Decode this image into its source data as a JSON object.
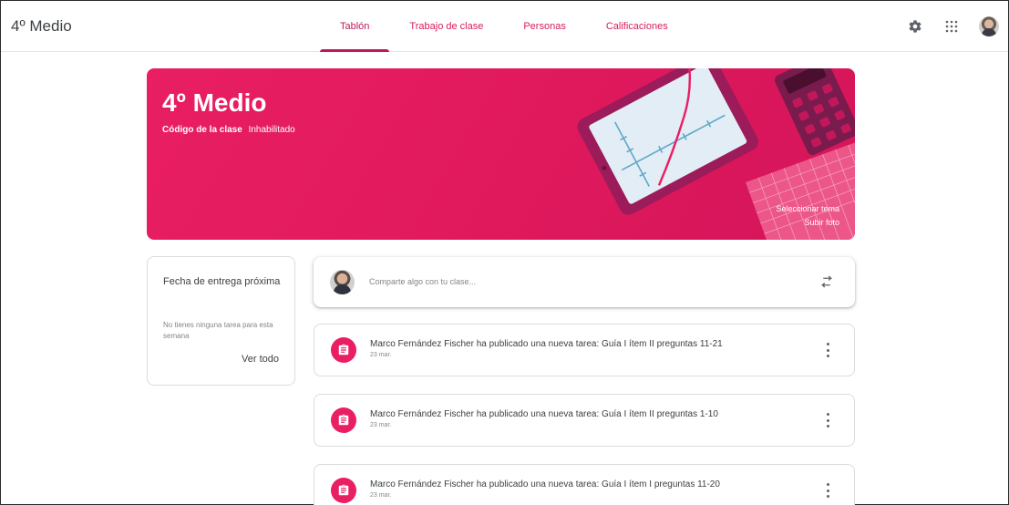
{
  "header": {
    "class_name": "4º Medio",
    "tabs": [
      {
        "label": "Tablón",
        "active": true
      },
      {
        "label": "Trabajo de clase",
        "active": false
      },
      {
        "label": "Personas",
        "active": false
      },
      {
        "label": "Calificaciones",
        "active": false
      }
    ],
    "icons": [
      "gear-icon",
      "apps-grid-icon",
      "avatar"
    ]
  },
  "banner": {
    "title": "4º Medio",
    "code_label": "Código de la clase",
    "code_value": "Inhabilitado",
    "select_theme": "Seleccionar tema",
    "upload_photo": "Subir foto",
    "color": "#e91e63"
  },
  "due_card": {
    "title": "Fecha de entrega próxima",
    "empty_text": "No tienes ninguna tarea para esta semana",
    "view_all": "Ver todo"
  },
  "share": {
    "placeholder": "Comparte algo con tu clase..."
  },
  "posts": [
    {
      "text": "Marco Fernández Fischer ha publicado una nueva tarea: Guía I ítem II preguntas 11-21",
      "date": "23 mar."
    },
    {
      "text": "Marco Fernández Fischer ha publicado una nueva tarea: Guía I ítem II preguntas 1-10",
      "date": "23 mar."
    },
    {
      "text": "Marco Fernández Fischer ha publicado una nueva tarea: Guía I ítem I preguntas 11-20",
      "date": "23 mar."
    }
  ],
  "colors": {
    "accent": "#c2185b",
    "post_icon": "#e91e63"
  }
}
